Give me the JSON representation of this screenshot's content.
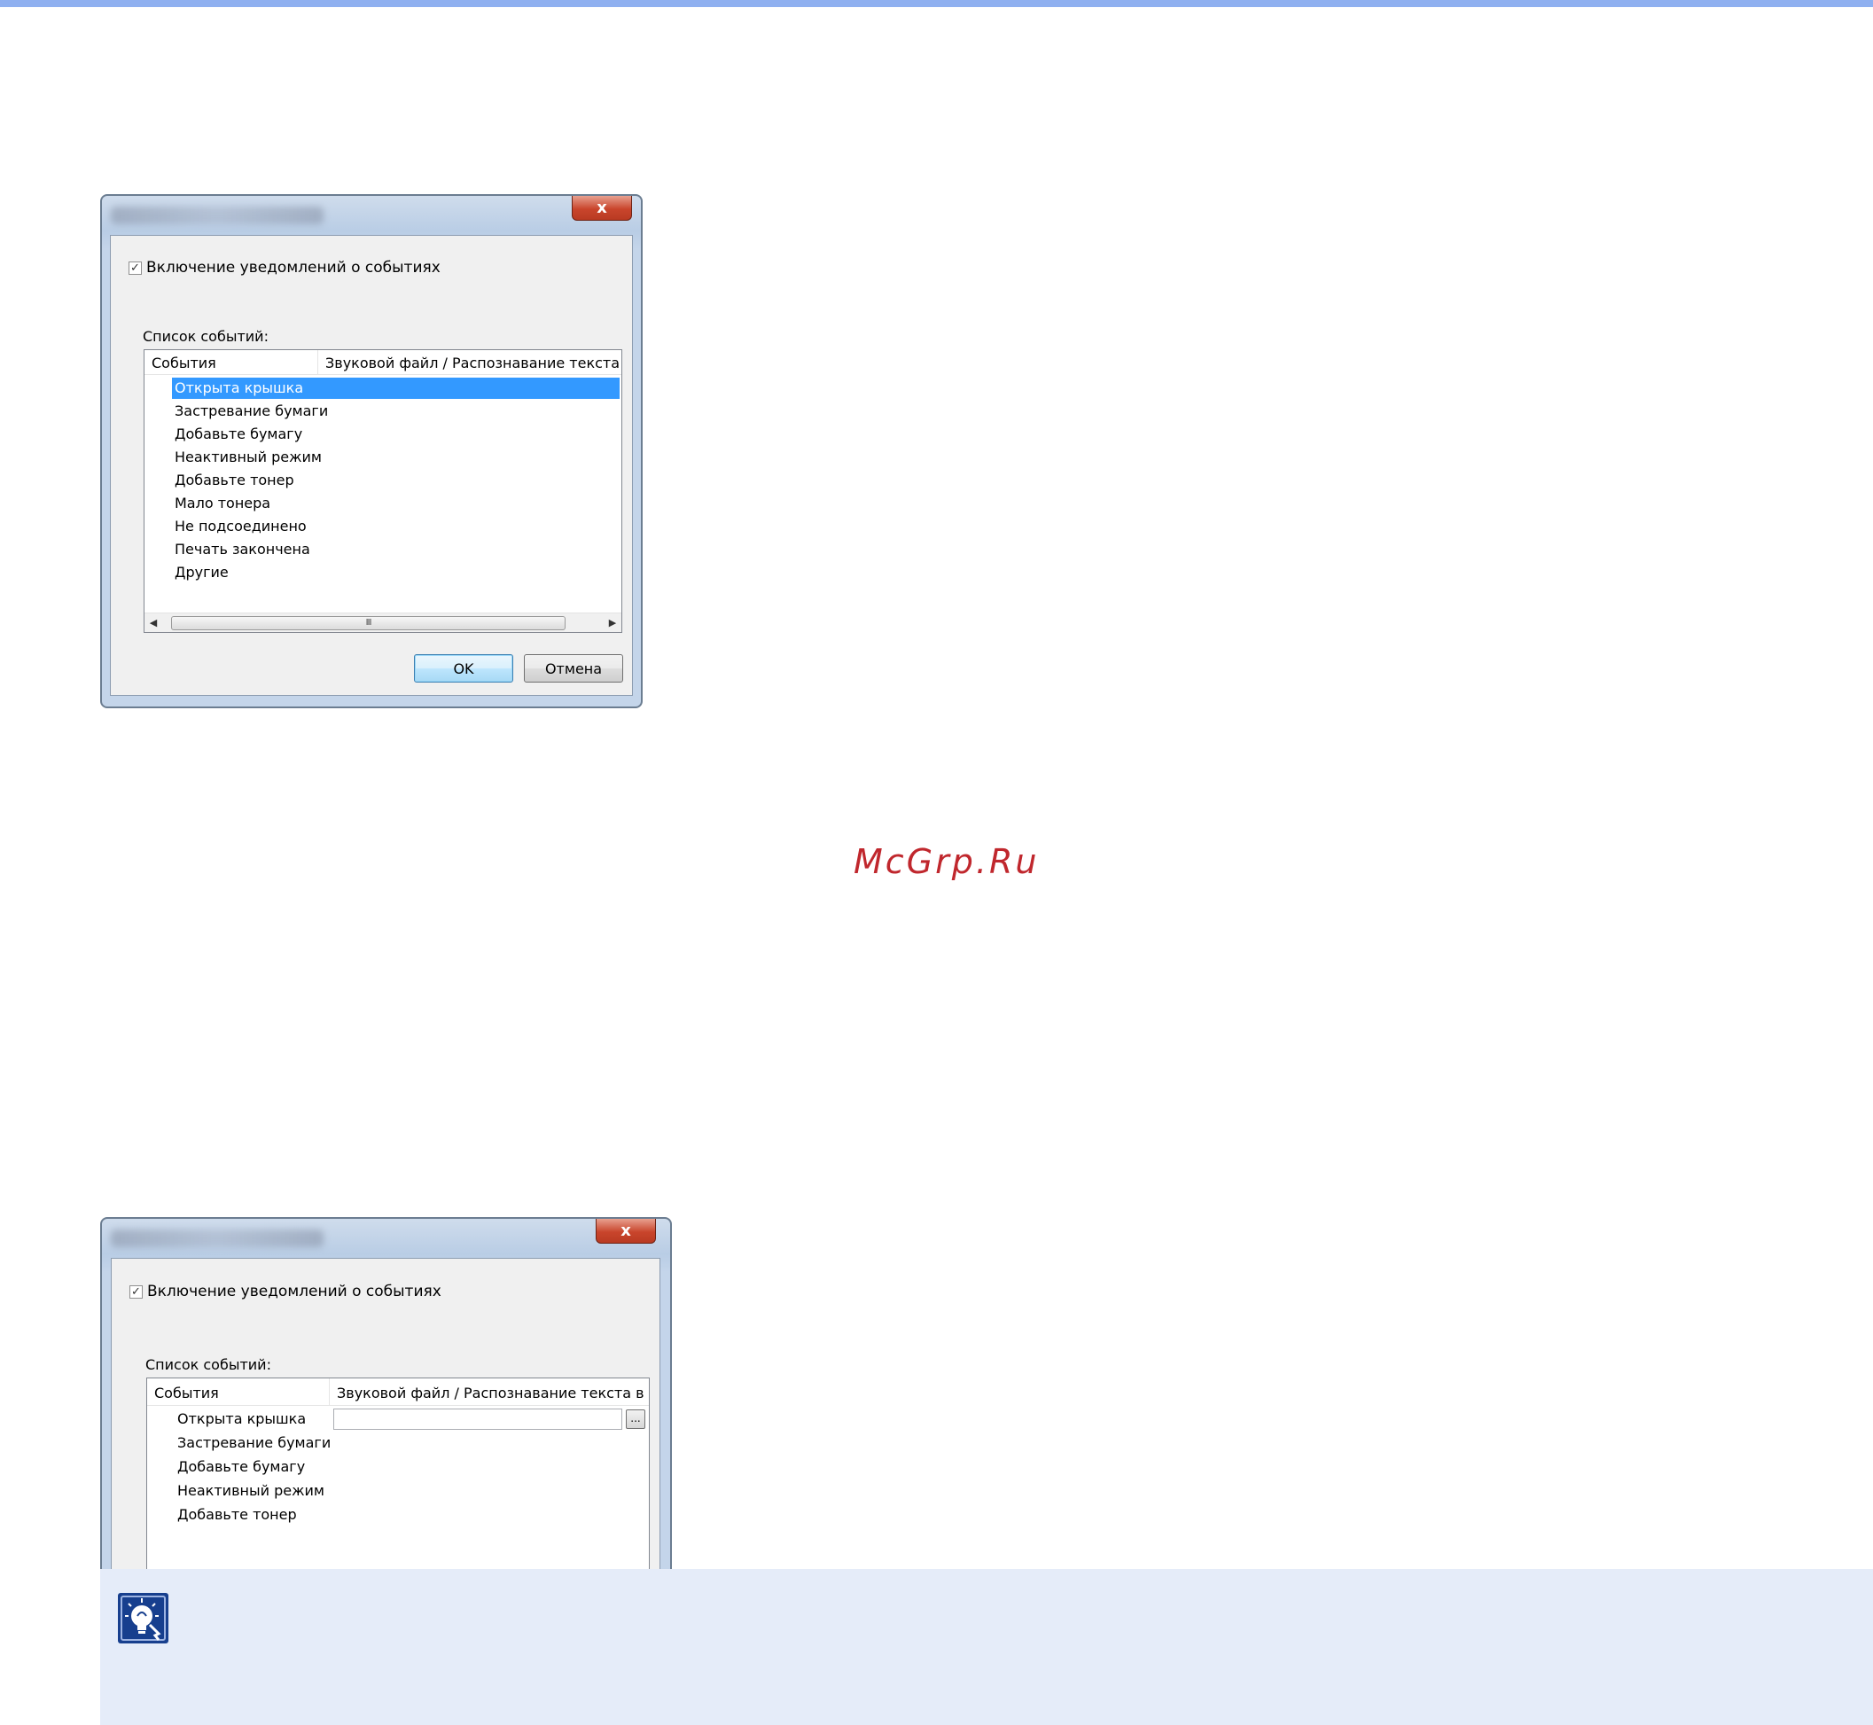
{
  "dialog1": {
    "close_glyph": "x",
    "enable_checkbox": {
      "checked": true,
      "check_glyph": "✓",
      "label": "Включение уведомлений о событиях"
    },
    "event_list_label": "Список событий:",
    "columns": {
      "events": "События",
      "sound": "Звуковой файл / Распознавание текста в р"
    },
    "events": [
      "Открыта крышка",
      "Застревание бумаги",
      "Добавьте бумагу",
      "Неактивный режим",
      "Добавьте тонер",
      "Мало тонера",
      "Не подсоединено",
      "Печать закончена",
      "Другие"
    ],
    "selected_index": 0,
    "scrollbar": {
      "left_arrow": "◀",
      "right_arrow": "▶",
      "grip": "III"
    },
    "ok_label": "OK",
    "cancel_label": "Отмена"
  },
  "dialog2": {
    "close_glyph": "x",
    "enable_checkbox": {
      "checked": true,
      "check_glyph": "✓",
      "label": "Включение уведомлений о событиях"
    },
    "event_list_label": "Список событий:",
    "columns": {
      "events": "События",
      "sound": "Звуковой файл / Распознавание текста в р"
    },
    "events": [
      "Открыта крышка",
      "Застревание бумаги",
      "Добавьте бумагу",
      "Неактивный режим",
      "Добавьте тонер"
    ],
    "sound_file_value": "",
    "browse_label": "..."
  },
  "watermark": "McGrp.Ru",
  "note": {
    "icon": "hint-lightbulb-icon"
  },
  "colors": {
    "accent_bar": "#8fb0f0",
    "selection": "#3399ff",
    "note_bg": "#e5ecf9",
    "watermark": "#c0272d"
  }
}
